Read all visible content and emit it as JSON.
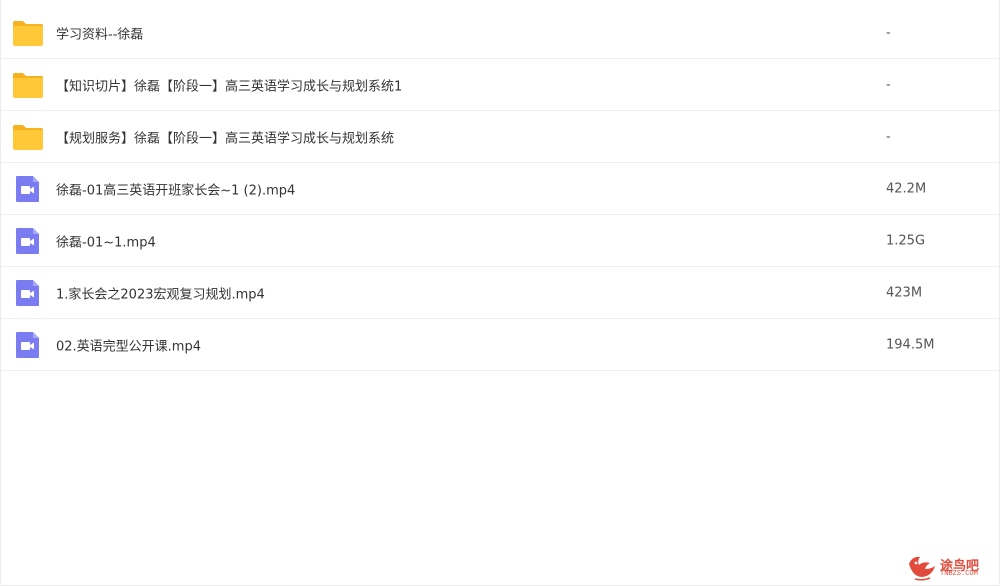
{
  "files": [
    {
      "name": "学习资料--徐磊",
      "size": "-",
      "type": "folder",
      "icon": "folder-icon"
    },
    {
      "name": "【知识切片】徐磊【阶段一】高三英语学习成长与规划系统1",
      "size": "-",
      "type": "folder",
      "icon": "folder-icon"
    },
    {
      "name": "【规划服务】徐磊【阶段一】高三英语学习成长与规划系统",
      "size": "-",
      "type": "folder",
      "icon": "folder-icon"
    },
    {
      "name": "徐磊-01高三英语开班家长会~1 (2).mp4",
      "size": "42.2M",
      "type": "video",
      "icon": "video-file-icon"
    },
    {
      "name": "徐磊-01~1.mp4",
      "size": "1.25G",
      "type": "video",
      "icon": "video-file-icon"
    },
    {
      "name": "1.家长会之2023宏观复习规划.mp4",
      "size": "423M",
      "type": "video",
      "icon": "video-file-icon"
    },
    {
      "name": "02.英语完型公开课.mp4",
      "size": "194.5M",
      "type": "video",
      "icon": "video-file-icon"
    }
  ],
  "colors": {
    "folder": "#FFC838",
    "folder_tab": "#F5B21E",
    "video": "#7B7CF2",
    "watermark": "#E24B3B"
  },
  "watermark": {
    "text": "途鸟吧",
    "sub": "TNBZS.COM",
    "icon": "bird-logo-icon"
  }
}
